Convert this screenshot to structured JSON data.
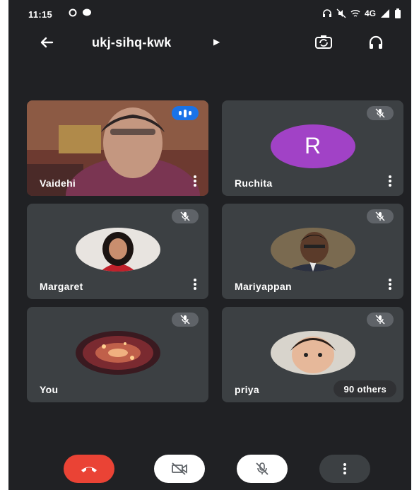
{
  "status_bar": {
    "time": "11:15",
    "network": "4G"
  },
  "header": {
    "meeting_code": "ukj-sihq-kwk"
  },
  "participants": [
    {
      "name": "Vaidehi",
      "state": "speaking",
      "video": "on"
    },
    {
      "name": "Ruchita",
      "state": "muted",
      "avatar_letter": "R",
      "avatar_color": "#a142c6"
    },
    {
      "name": "Margaret",
      "state": "muted"
    },
    {
      "name": "Mariyappan",
      "state": "muted"
    },
    {
      "name": "You",
      "state": "muted"
    },
    {
      "name": "priya",
      "state": "muted",
      "others_label": "90 others"
    }
  ],
  "controls": [
    "end-call",
    "camera-off",
    "mic-off",
    "more-options"
  ],
  "colors": {
    "background": "#202124",
    "tile": "#3c4043",
    "end_call": "#ea4335",
    "speaking": "#1a73e8"
  }
}
